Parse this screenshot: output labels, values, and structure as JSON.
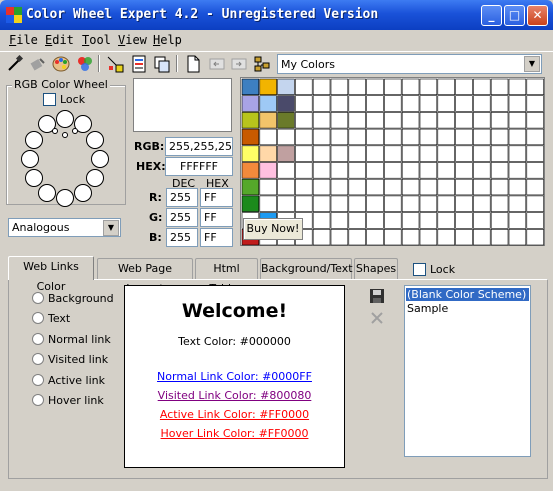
{
  "window": {
    "title": "Color Wheel Expert 4.2 - Unregistered Version",
    "buttons": [
      "_",
      "□",
      "✕"
    ]
  },
  "menu": [
    {
      "ul": "F",
      "rest": "ile"
    },
    {
      "ul": "E",
      "rest": "dit"
    },
    {
      "ul": "T",
      "rest": "ool"
    },
    {
      "ul": "V",
      "rest": "iew"
    },
    {
      "ul": "H",
      "rest": "elp"
    }
  ],
  "toolbar": {
    "icons": [
      "eyedropper-icon",
      "paint-bucket-icon",
      "palette-icon",
      "color-mix-icon",
      "swatch-icon",
      "web-page-icon",
      "copy-icon",
      "new-document-icon",
      "back-icon",
      "forward-icon",
      "tree-icon"
    ],
    "palette_select": "My Colors"
  },
  "wheel": {
    "group_title": "RGB Color Wheel",
    "lock_label": "Lock",
    "scheme": "Analogous"
  },
  "color": {
    "rgb_label": "RGB:",
    "rgb_value": "255,255,255",
    "hex_label": "HEX:",
    "hex_value": "FFFFFF",
    "dec_header": "DEC",
    "hex_header": "HEX",
    "channels": [
      {
        "label": "R:",
        "dec": "255",
        "hex": "FF"
      },
      {
        "label": "G:",
        "dec": "255",
        "hex": "FF"
      },
      {
        "label": "B:",
        "dec": "255",
        "hex": "FF"
      }
    ]
  },
  "palette": {
    "colors": [
      "#3d7fc1",
      "#f2b400",
      "#c4d5ee",
      "#a8a3e6",
      "#9ec9f5",
      "#4a4a6a",
      "#b8c41c",
      "#f2c46a",
      "#6a7a2a",
      "#c85a00",
      "#ffffff",
      "#ffffff",
      "#ffff66",
      "#ffd8a8",
      "#c0a0a0",
      "#f28a3c",
      "#ffc0e0",
      "#ffffff",
      "#55a82a",
      "#ffffff",
      "#ffffff",
      "#1c8a1c",
      "#ffffff",
      "#ffffff",
      "#ffffff",
      "#1c9af2",
      "#ffffff",
      "#c01c1c",
      "#ffffff",
      "#ffffff"
    ],
    "buy_label": "Buy Now!"
  },
  "tabs": {
    "items": [
      "Web Links Color",
      "Web Page Layout",
      "Html Tables",
      "Background/Text",
      "Shapes"
    ],
    "lock_label": "Lock"
  },
  "links_panel": {
    "options": [
      "Background",
      "Text",
      "Normal link",
      "Visited link",
      "Active link",
      "Hover link"
    ],
    "preview": {
      "heading": "Welcome!",
      "text_color": "Text Color: #000000",
      "normal": "Normal Link Color: #0000FF",
      "visited": "Visited Link Color: #800080",
      "active": "Active Link Color: #FF0000",
      "hover": "Hover Link Color: #FF0000"
    },
    "schemes": [
      "(Blank Color Scheme)",
      "Sample"
    ]
  }
}
